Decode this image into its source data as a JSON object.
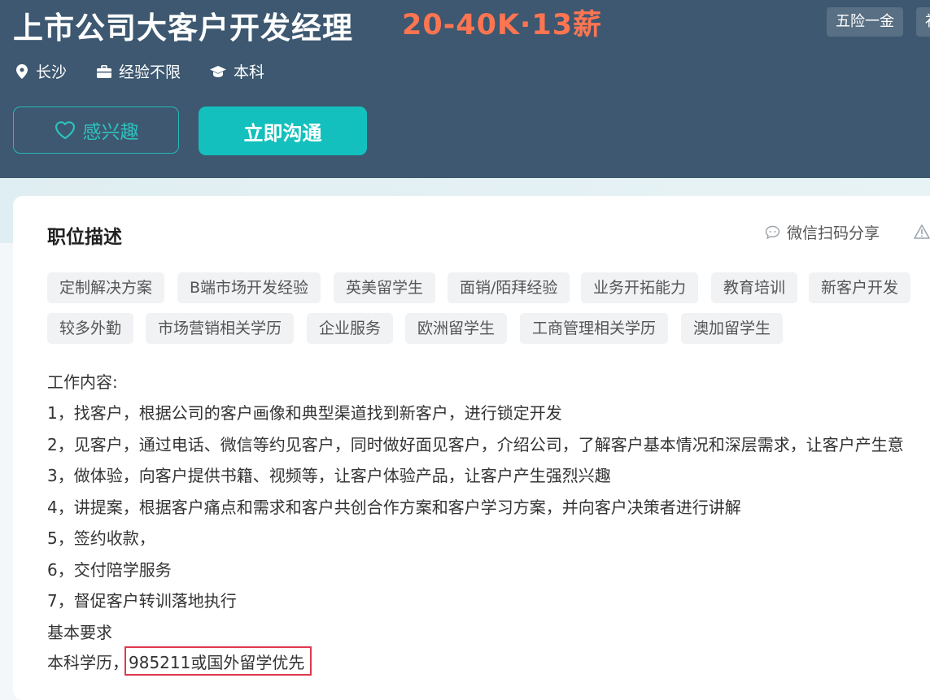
{
  "job": {
    "title": "上市公司大客户开发经理",
    "salary": "20-40K·13薪",
    "welfare": [
      "五险一金",
      "补"
    ],
    "location": "长沙",
    "experience": "经验不限",
    "education": "本科"
  },
  "actions": {
    "interest_label": "感兴趣",
    "chat_label": "立即沟通"
  },
  "description": {
    "section_title": "职位描述",
    "share_label": "微信扫码分享",
    "tags": [
      "定制解决方案",
      "B端市场开发经验",
      "英美留学生",
      "面销/陌拜经验",
      "业务开拓能力",
      "教育培训",
      "新客户开发",
      "较多外勤",
      "市场营销相关学历",
      "企业服务",
      "欧洲留学生",
      "工商管理相关学历",
      "澳加留学生"
    ],
    "lines": [
      "工作内容:",
      "1，找客户，根据公司的客户画像和典型渠道找到新客户，进行锁定开发",
      "2，见客户，通过电话、微信等约见客户，同时做好面见客户，介绍公司，了解客户基本情况和深层需求，让客户产生意",
      "3，做体验，向客户提供书籍、视频等，让客户体验产品，让客户产生强烈兴趣",
      "4，讲提案，根据客户痛点和需求和客户共创合作方案和客户学习方案，并向客户决策者进行讲解",
      "5，签约收款，",
      "6，交付陪学服务",
      "7，督促客户转训落地执行",
      "基本要求",
      "本科学历，985211或国外留学优先"
    ]
  },
  "colors": {
    "header_bg": "#3d5870",
    "salary": "#ff7552",
    "accent": "#13c0bd",
    "highlight": "#e0384f"
  },
  "icons": [
    "location-pin-icon",
    "briefcase-icon",
    "graduation-cap-icon",
    "heart-icon",
    "chat-bubble-icon",
    "warning-icon"
  ]
}
